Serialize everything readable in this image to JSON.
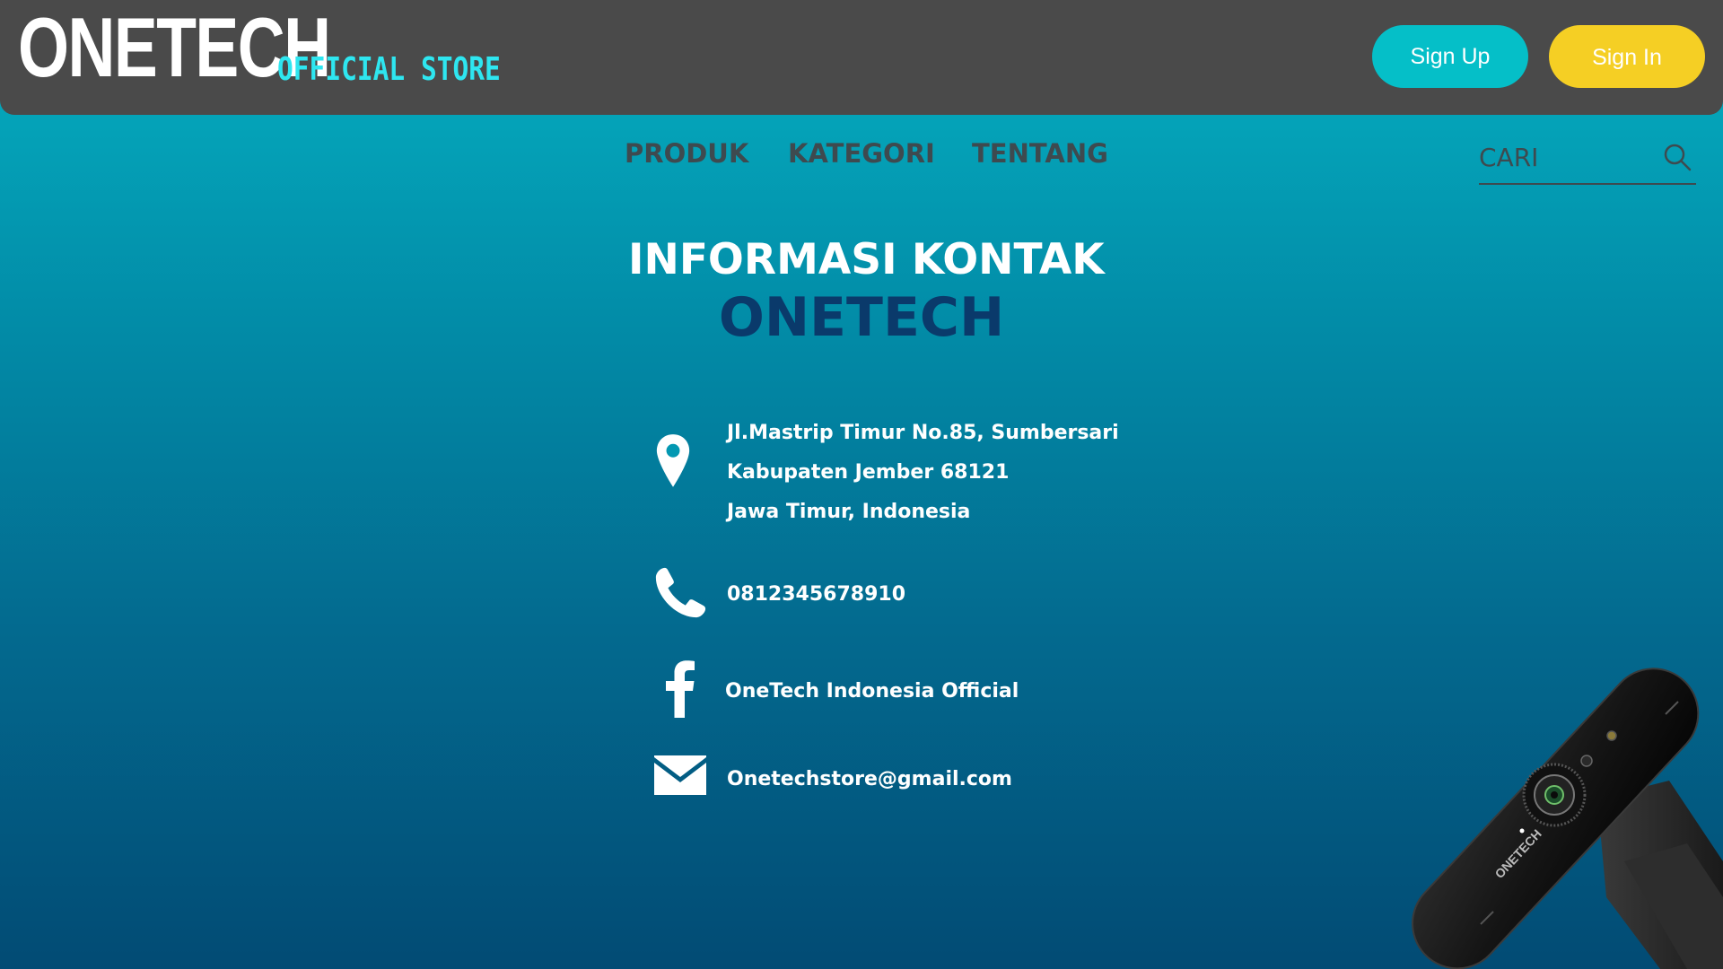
{
  "header": {
    "brand": "ONETECH",
    "brand_sub": "OFFICIAL STORE",
    "signup_label": "Sign Up",
    "signin_label": "Sign In",
    "colors": {
      "bar": "#4a4a4a",
      "signup": "#05bfc8",
      "signin": "#f5cf24",
      "brand_sub": "#2ee6f0"
    }
  },
  "nav": {
    "items": [
      {
        "label": "PRODUK"
      },
      {
        "label": "KATEGORI"
      },
      {
        "label": "TENTANG"
      }
    ],
    "search": {
      "placeholder": "CARI",
      "icon": "search-icon"
    }
  },
  "main": {
    "title": "INFORMASI KONTAK",
    "subtitle": "ONETECH",
    "contacts": {
      "address": {
        "icon": "map-pin-icon",
        "lines": [
          "Jl.Mastrip Timur No.85, Sumbersari",
          "Kabupaten Jember 68121",
          "Jawa Timur, Indonesia"
        ]
      },
      "phone": {
        "icon": "phone-icon",
        "value": "0812345678910"
      },
      "facebook": {
        "icon": "facebook-icon",
        "value": "OneTech Indonesia Official"
      },
      "email": {
        "icon": "mail-icon",
        "value": "Onetechstore@gmail.com"
      }
    }
  },
  "product_image": {
    "label": "ONETECH"
  }
}
